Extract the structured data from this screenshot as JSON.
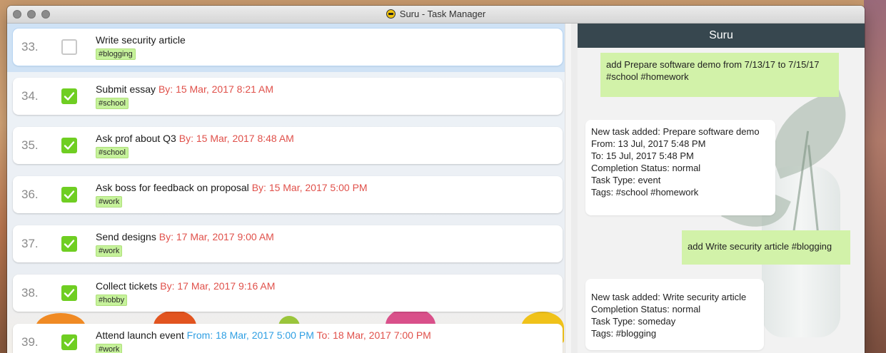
{
  "window": {
    "title": "Suru - Task Manager"
  },
  "tasks": [
    {
      "num": "33.",
      "name": "Write security article",
      "date_prefix": "",
      "date": "",
      "date_type": "none",
      "tag": "#blogging",
      "done": false,
      "selected": true
    },
    {
      "num": "34.",
      "name": "Submit essay",
      "date_prefix": "By:",
      "date": "15 Mar, 2017 8:21 AM",
      "date_type": "by",
      "tag": "#school",
      "done": true
    },
    {
      "num": "35.",
      "name": "Ask prof about Q3",
      "date_prefix": "By:",
      "date": "15 Mar, 2017 8:48 AM",
      "date_type": "by",
      "tag": "#school",
      "done": true
    },
    {
      "num": "36.",
      "name": "Ask boss for feedback on proposal",
      "date_prefix": "By:",
      "date": "15 Mar, 2017 5:00 PM",
      "date_type": "by",
      "tag": "#work",
      "done": true
    },
    {
      "num": "37.",
      "name": "Send designs",
      "date_prefix": "By:",
      "date": "17 Mar, 2017 9:00 AM",
      "date_type": "by",
      "tag": "#work",
      "done": true
    },
    {
      "num": "38.",
      "name": "Collect tickets",
      "date_prefix": "By:",
      "date": "17 Mar, 2017 9:16 AM",
      "date_type": "by",
      "tag": "#hobby",
      "done": true
    },
    {
      "num": "39.",
      "name": "Attend launch event",
      "date_prefix": "From:",
      "date": "18 Mar, 2017 5:00 PM",
      "date_suffix": "To: 18 Mar, 2017 7:00 PM",
      "date_type": "range",
      "tag": "#work",
      "done": true
    }
  ],
  "chat": {
    "header": "Suru",
    "messages": [
      {
        "from": "user",
        "lines": [
          "add Prepare software demo from 7/13/17 to 7/15/17",
          "#school #homework"
        ]
      },
      {
        "from": "bot",
        "lines": [
          "New task added: Prepare software demo",
          "From: 13 Jul, 2017 5:48 PM",
          "To: 15 Jul, 2017 5:48 PM",
          "Completion Status: normal",
          "Task Type: event",
          "Tags: #school #homework"
        ]
      },
      {
        "from": "user",
        "lines": [
          "add Write security article #blogging"
        ]
      },
      {
        "from": "bot",
        "lines": [
          "New task added: Write security article",
          "Completion Status: normal",
          "Task Type: someday",
          "Tags: #blogging"
        ]
      }
    ]
  },
  "colors": {
    "accent_green": "#6fce22",
    "due_red": "#e0504a",
    "range_blue": "#2f9fe3",
    "tag_bg": "#c6f29b",
    "user_bubble": "#d2f2a9",
    "chat_header": "#37474f"
  },
  "icons": {
    "window_close": "close-icon",
    "window_minimize": "minimize-icon",
    "window_zoom": "zoom-icon",
    "app": "app-icon",
    "done": "checkmark-icon"
  }
}
